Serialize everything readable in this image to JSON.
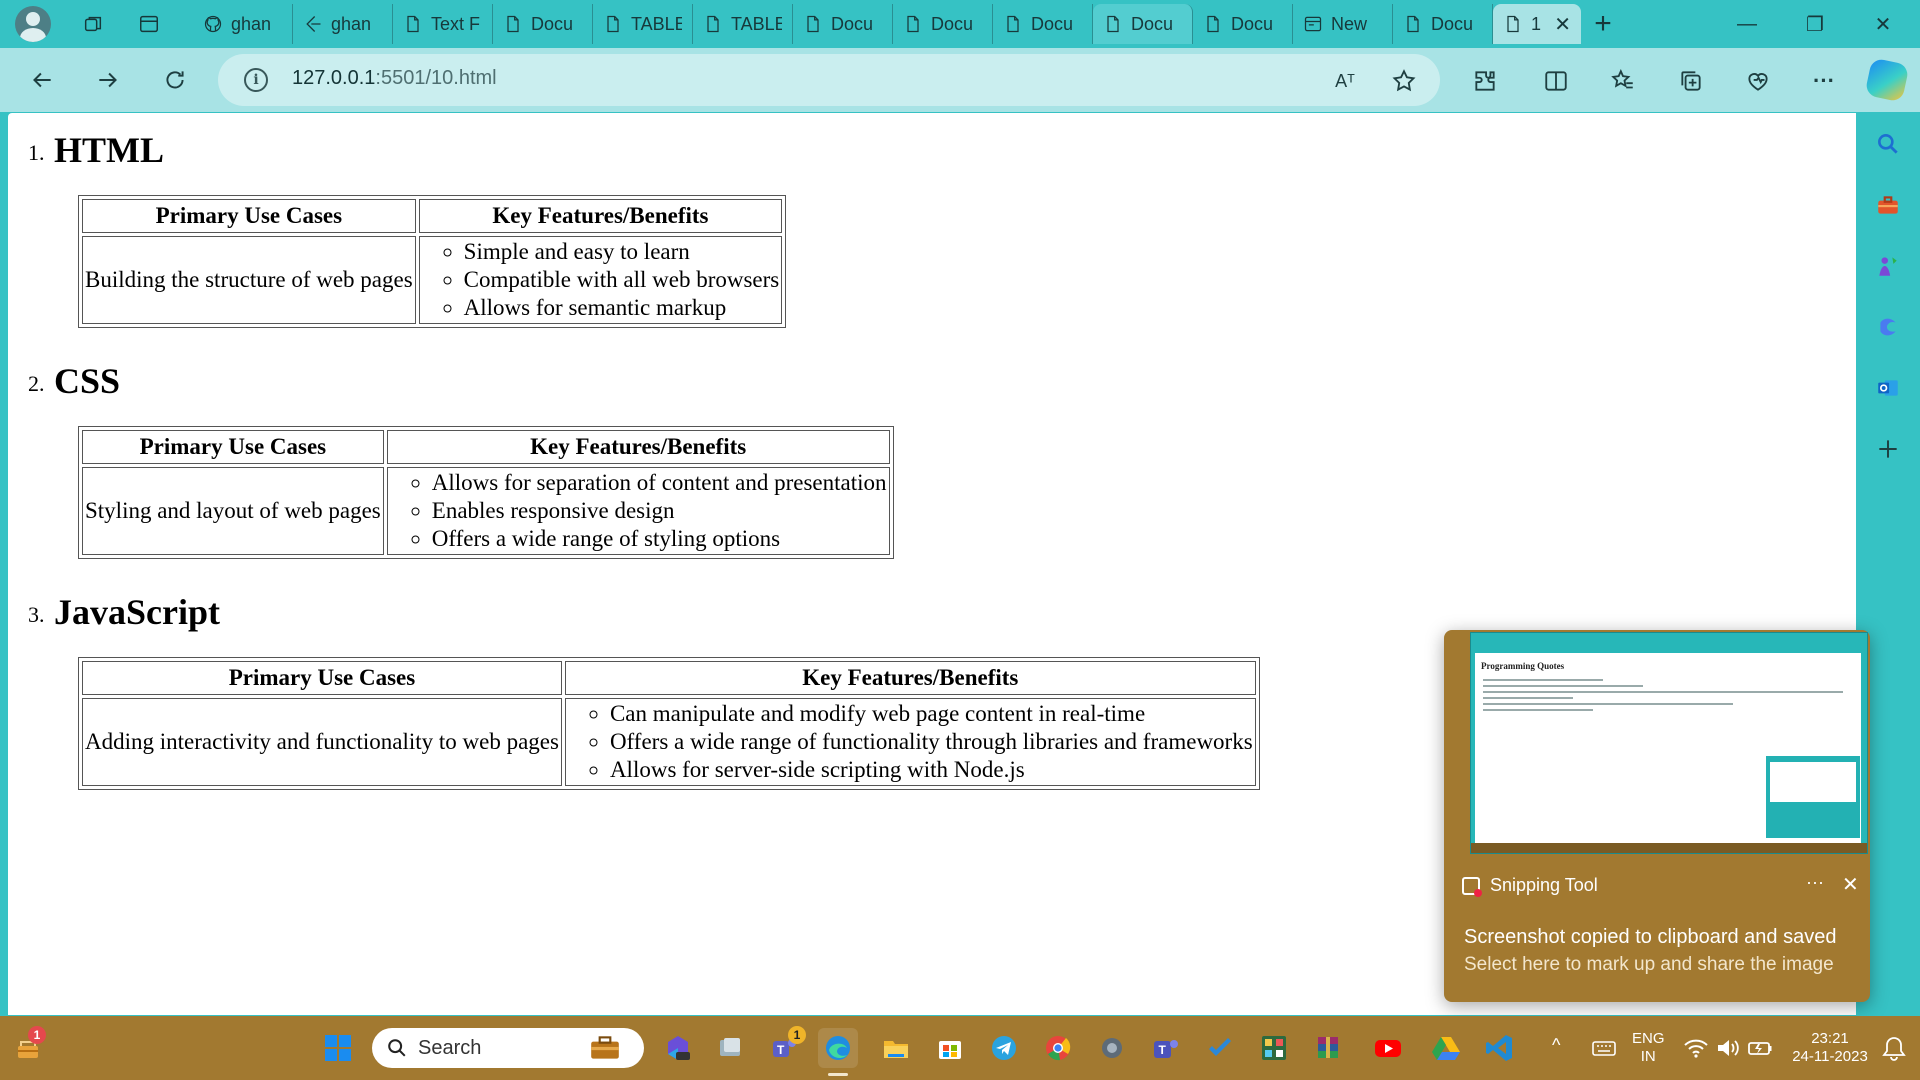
{
  "browser": {
    "tabs": [
      {
        "label": "ghan",
        "icon": "github-icon"
      },
      {
        "label": "ghan",
        "icon": "dev-icon"
      },
      {
        "label": "Text F",
        "icon": "page-icon"
      },
      {
        "label": "Docu",
        "icon": "page-icon"
      },
      {
        "label": "TABLE",
        "icon": "page-icon"
      },
      {
        "label": "TABLE",
        "icon": "page-icon"
      },
      {
        "label": "Docu",
        "icon": "page-icon"
      },
      {
        "label": "Docu",
        "icon": "page-icon"
      },
      {
        "label": "Docu",
        "icon": "page-icon"
      },
      {
        "label": "Docu",
        "icon": "page-icon"
      },
      {
        "label": "Docu",
        "icon": "page-icon"
      },
      {
        "label": "New",
        "icon": "window-icon"
      },
      {
        "label": "Docu",
        "icon": "page-icon"
      }
    ],
    "active_tab": {
      "label": "1",
      "close": "✕"
    },
    "new_tab": "+",
    "address": {
      "host": "127.0.0.1",
      "rest": ":5501/10.html"
    },
    "window_controls": {
      "minimize": "—",
      "maximize": "❐",
      "close": "✕"
    },
    "read_aloud_label": "Aᵀ"
  },
  "page": {
    "languages": [
      {
        "number": "1.",
        "title": "HTML",
        "headers": [
          "Primary Use Cases",
          "Key Features/Benefits"
        ],
        "use_case": "Building the structure of web pages",
        "features": [
          "Simple and easy to learn",
          "Compatible with all web browsers",
          "Allows for semantic markup"
        ]
      },
      {
        "number": "2.",
        "title": "CSS",
        "headers": [
          "Primary Use Cases",
          "Key Features/Benefits"
        ],
        "use_case": "Styling and layout of web pages",
        "features": [
          "Allows for separation of content and presentation",
          "Enables responsive design",
          "Offers a wide range of styling options"
        ]
      },
      {
        "number": "3.",
        "title": "JavaScript",
        "headers": [
          "Primary Use Cases",
          "Key Features/Benefits"
        ],
        "use_case": "Adding interactivity and functionality to web pages",
        "features": [
          "Can manipulate and modify web page content in real-time",
          "Offers a wide range of functionality through libraries and frameworks",
          "Allows for server-side scripting with Node.js"
        ]
      }
    ]
  },
  "notification": {
    "app": "Snipping Tool",
    "more": "···",
    "close": "✕",
    "line1": "Screenshot copied to clipboard and saved",
    "line2": "Select here to mark up and share the image",
    "thumbnail_title": "Programming Quotes"
  },
  "taskbar": {
    "search_label": "Search",
    "weather_badge": "1",
    "teams_badge": "1",
    "language": {
      "top": "ENG",
      "bottom": "IN"
    },
    "time": "23:21",
    "date": "24-11-2023",
    "chevron": "^"
  },
  "colors": {
    "frame": "#36c2c4",
    "toolbar": "#a8e3e5",
    "taskbar": "#a27930",
    "page": "#ffffff"
  }
}
